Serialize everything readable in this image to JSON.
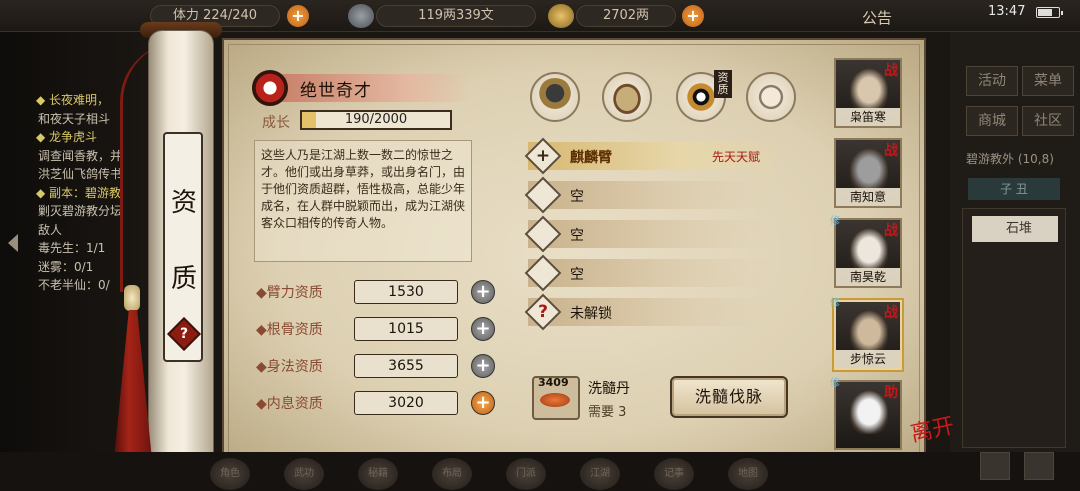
{
  "topbar": {
    "stamina": "体力 224/240",
    "silver": "119两339文",
    "gold": "2702两",
    "notice": "公告",
    "clock": "13:47"
  },
  "quest_log": [
    {
      "text": "◆ 长夜难明，",
      "style": "yellow"
    },
    {
      "text": "和夜天子相斗",
      "style": "white"
    },
    {
      "text": "◆ 龙争虎斗",
      "style": "yellow"
    },
    {
      "text": "调查闻香教，并",
      "style": "white"
    },
    {
      "text": "洪芝仙飞鸽传书",
      "style": "white"
    },
    {
      "text": "◆ 副本：碧游教",
      "style": "yellow"
    },
    {
      "text": "剿灭碧游教分坛",
      "style": "white"
    },
    {
      "text": "敌人",
      "style": "white"
    },
    {
      "text": "毒先生：1/1",
      "style": "white"
    },
    {
      "text": "迷雾：0/1",
      "style": "white"
    },
    {
      "text": "不老半仙：0/",
      "style": "white"
    }
  ],
  "right_menu": {
    "buttons": [
      "活动",
      "菜单",
      "商城",
      "社区"
    ],
    "location": "碧游教外 (10,8)",
    "time_tag": "子 丑",
    "stone": "石堆"
  },
  "scroll": {
    "chars": [
      "资",
      "质"
    ],
    "help": "?"
  },
  "aptitude": {
    "title": "绝世奇才",
    "growth_label": "成长",
    "growth_text": "190/2000",
    "growth_current": 190,
    "growth_max": 2000,
    "description": "这些人乃是江湖上数一数二的惊世之才。他们或出身草莽，或出身名门，由于他们资质超群，悟性极高，总能少年成名，在人群中脱颖而出，成为江湖侠客众口相传的传奇人物。",
    "attributes": [
      {
        "label": "◆臂力资质",
        "value": "1530",
        "plus": "grey"
      },
      {
        "label": "◆根骨资质",
        "value": "1015",
        "plus": "grey"
      },
      {
        "label": "◆身法资质",
        "value": "3655",
        "plus": "grey"
      },
      {
        "label": "◆内息资质",
        "value": "3020",
        "plus": "orange"
      }
    ],
    "plus_symbol": "+"
  },
  "icon_tabs": [
    {
      "icon": "straw-hat-hero-icon"
    },
    {
      "icon": "cloth-bundle-icon"
    },
    {
      "icon": "yin-yang-bagua-icon"
    },
    {
      "icon": "martial-pose-icon"
    }
  ],
  "icon_tab_tag": "资质",
  "talents": [
    {
      "mark": "+",
      "name": "麒麟臂",
      "type": "先天天赋",
      "highlight": true
    },
    {
      "mark": "",
      "name": "空",
      "type": "",
      "highlight": false
    },
    {
      "mark": "",
      "name": "空",
      "type": "",
      "highlight": false
    },
    {
      "mark": "",
      "name": "空",
      "type": "",
      "highlight": false
    },
    {
      "mark": "?",
      "name": "未解锁",
      "type": "",
      "highlight": false
    }
  ],
  "wash": {
    "pill_count": "3409",
    "pill_name": "洗髓丹",
    "requirement": "需要 3",
    "button": "洗髓伐脉"
  },
  "heroes": [
    {
      "name": "枭笛寒",
      "tag": "战",
      "side": ""
    },
    {
      "name": "南知意",
      "tag": "战",
      "side": ""
    },
    {
      "name": "南昊乾",
      "tag": "战",
      "side": "修"
    },
    {
      "name": "步惊云",
      "tag": "战",
      "side": "修"
    },
    {
      "name": "",
      "tag": "助",
      "side": "修"
    }
  ],
  "leave_label": "离开",
  "bottom_nav": [
    "角色",
    "武功",
    "秘籍",
    "布局",
    "门派",
    "江湖",
    "记事",
    "地图"
  ]
}
